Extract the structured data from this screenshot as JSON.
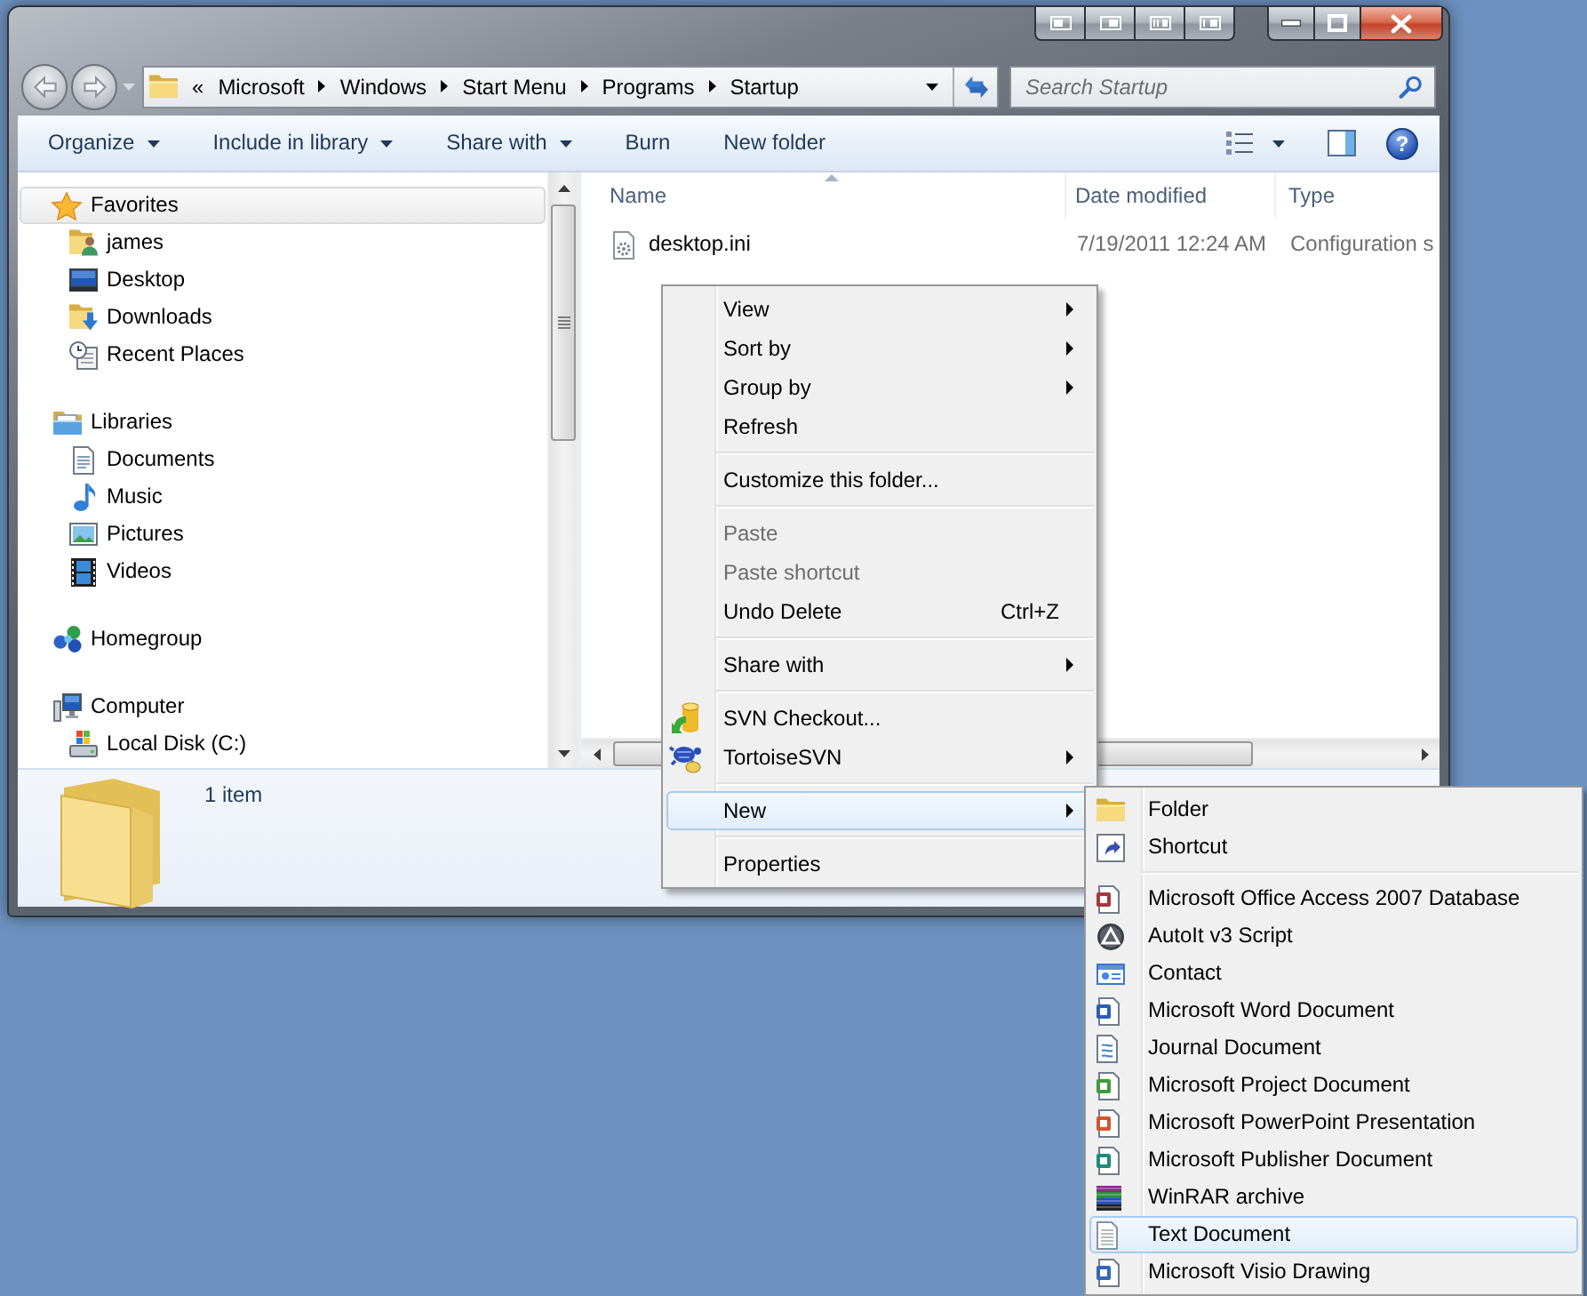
{
  "address_bar": {
    "overflow": "«",
    "crumbs": [
      "Microsoft",
      "Windows",
      "Start Menu",
      "Programs",
      "Startup"
    ]
  },
  "search": {
    "placeholder": "Search Startup"
  },
  "toolbar": {
    "buttons": [
      {
        "label": "Organize",
        "dropdown": true
      },
      {
        "label": "Include in library",
        "dropdown": true
      },
      {
        "label": "Share with",
        "dropdown": true
      },
      {
        "label": "Burn",
        "dropdown": false
      },
      {
        "label": "New folder",
        "dropdown": false
      }
    ],
    "help": "?"
  },
  "nav_pane": {
    "groups": [
      {
        "label": "Favorites",
        "selected": true,
        "children": [
          {
            "label": "james",
            "selected": false
          },
          {
            "label": "Desktop",
            "selected": false
          },
          {
            "label": "Downloads",
            "selected": false
          },
          {
            "label": "Recent Places",
            "selected": false
          }
        ]
      },
      {
        "label": "Libraries",
        "selected": false,
        "children": [
          {
            "label": "Documents",
            "selected": false
          },
          {
            "label": "Music",
            "selected": false
          },
          {
            "label": "Pictures",
            "selected": false
          },
          {
            "label": "Videos",
            "selected": false
          }
        ]
      },
      {
        "label": "Homegroup",
        "selected": false
      },
      {
        "label": "Computer",
        "selected": false,
        "children": [
          {
            "label": "Local Disk (C:)",
            "selected": false
          }
        ]
      }
    ]
  },
  "file_list": {
    "columns": [
      {
        "label": "Name",
        "sorted": true
      },
      {
        "label": "Date modified",
        "sorted": false
      },
      {
        "label": "Type",
        "sorted": false
      }
    ],
    "rows": [
      {
        "name": "desktop.ini",
        "date_modified": "7/19/2011 12:24 AM",
        "type": "Configuration s",
        "selected": false
      }
    ]
  },
  "details_pane": {
    "summary": "1 item"
  },
  "context_menu": {
    "groups": [
      [
        {
          "label": "View",
          "has_submenu": true,
          "disabled": false,
          "selected": false
        },
        {
          "label": "Sort by",
          "has_submenu": true,
          "disabled": false,
          "selected": false
        },
        {
          "label": "Group by",
          "has_submenu": true,
          "disabled": false,
          "selected": false
        },
        {
          "label": "Refresh",
          "has_submenu": false,
          "disabled": false,
          "selected": false
        }
      ],
      [
        {
          "label": "Customize this folder...",
          "has_submenu": false,
          "disabled": false,
          "selected": false
        }
      ],
      [
        {
          "label": "Paste",
          "has_submenu": false,
          "disabled": true,
          "selected": false
        },
        {
          "label": "Paste shortcut",
          "has_submenu": false,
          "disabled": true,
          "selected": false
        },
        {
          "label": "Undo Delete",
          "shortcut": "Ctrl+Z",
          "has_submenu": false,
          "disabled": false,
          "selected": false
        }
      ],
      [
        {
          "label": "Share with",
          "has_submenu": true,
          "disabled": false,
          "selected": false
        }
      ],
      [
        {
          "label": "SVN Checkout...",
          "has_submenu": false,
          "disabled": false,
          "selected": false
        },
        {
          "label": "TortoiseSVN",
          "has_submenu": true,
          "disabled": false,
          "selected": false
        }
      ],
      [
        {
          "label": "New",
          "has_submenu": true,
          "disabled": false,
          "selected": true
        }
      ],
      [
        {
          "label": "Properties",
          "has_submenu": false,
          "disabled": false,
          "selected": false
        }
      ]
    ]
  },
  "submenu": {
    "groups": [
      [
        {
          "label": "Folder",
          "selected": false
        },
        {
          "label": "Shortcut",
          "selected": false
        }
      ],
      [
        {
          "label": "Microsoft Office Access 2007 Database",
          "selected": false
        },
        {
          "label": "AutoIt v3 Script",
          "selected": false
        },
        {
          "label": "Contact",
          "selected": false
        },
        {
          "label": "Microsoft Word Document",
          "selected": false
        },
        {
          "label": "Journal Document",
          "selected": false
        },
        {
          "label": "Microsoft Project Document",
          "selected": false
        },
        {
          "label": "Microsoft PowerPoint Presentation",
          "selected": false
        },
        {
          "label": "Microsoft Publisher Document",
          "selected": false
        },
        {
          "label": "WinRAR archive",
          "selected": false
        },
        {
          "label": "Text Document",
          "selected": true
        },
        {
          "label": "Microsoft Visio Drawing",
          "selected": false
        }
      ]
    ]
  }
}
